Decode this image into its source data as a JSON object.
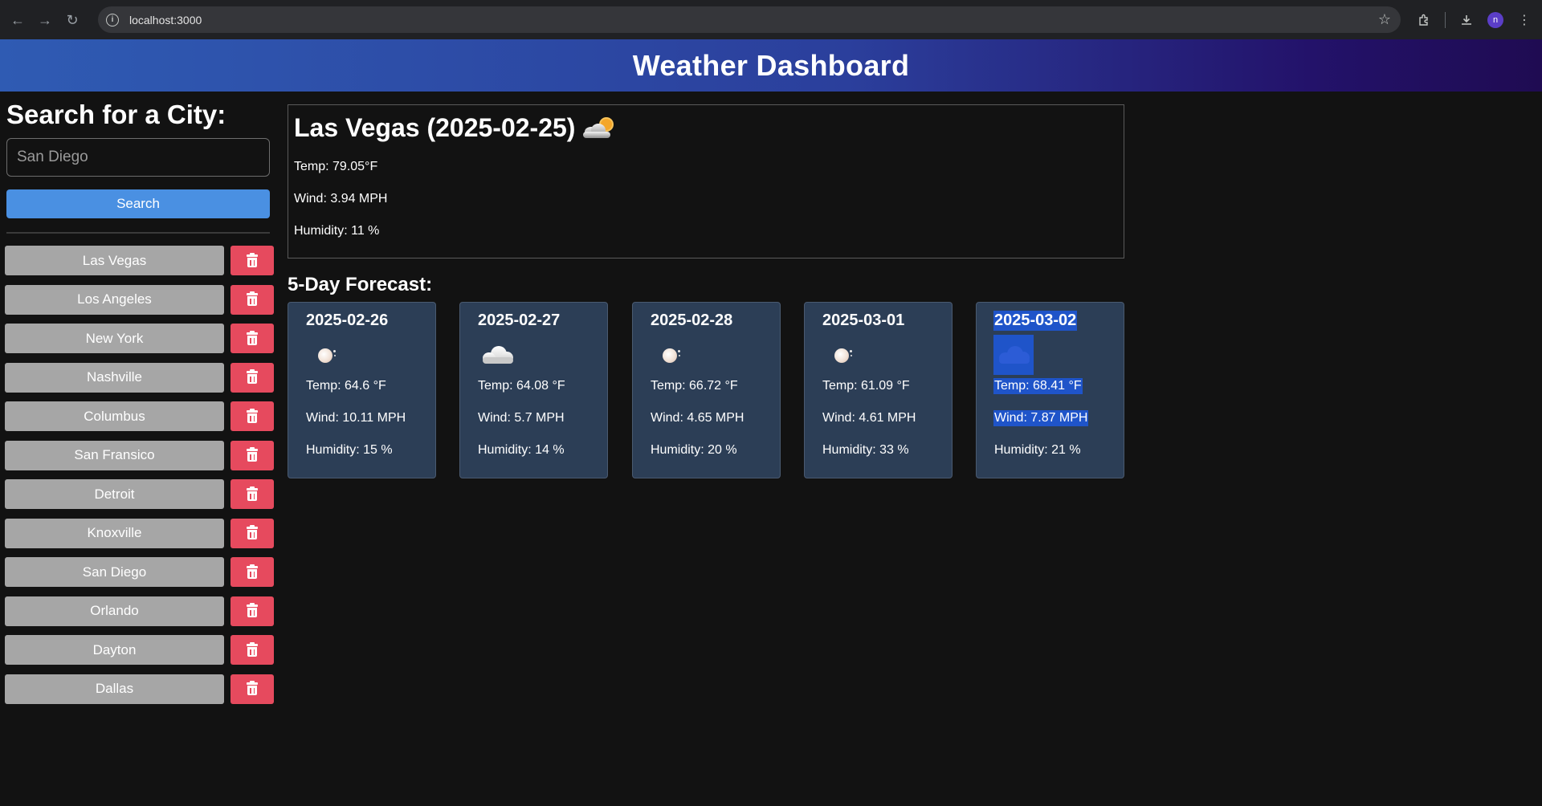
{
  "browser": {
    "url": "localhost:3000",
    "profile_initial": "n"
  },
  "header": {
    "title": "Weather Dashboard"
  },
  "sidebar": {
    "title": "Search for a City:",
    "search_placeholder": "San Diego",
    "search_label": "Search",
    "history": [
      {
        "label": "Las Vegas"
      },
      {
        "label": "Los Angeles"
      },
      {
        "label": "New York"
      },
      {
        "label": "Nashville"
      },
      {
        "label": "Columbus"
      },
      {
        "label": "San Fransico"
      },
      {
        "label": "Detroit"
      },
      {
        "label": "Knoxville"
      },
      {
        "label": "San Diego"
      },
      {
        "label": "Orlando"
      },
      {
        "label": "Dayton"
      },
      {
        "label": "Dallas"
      }
    ]
  },
  "current": {
    "heading": "Las Vegas (2025-02-25)",
    "icon": "partly-cloudy-icon",
    "temp": "Temp: 79.05°F",
    "wind": "Wind: 3.94 MPH",
    "humidity": "Humidity: 11 %"
  },
  "forecast": {
    "title": "5-Day Forecast:",
    "days": [
      {
        "date": "2025-02-26",
        "icon": "clear-sky-icon",
        "temp": "Temp: 64.6 °F",
        "wind": "Wind: 10.11 MPH",
        "humidity": "Humidity: 15 %"
      },
      {
        "date": "2025-02-27",
        "icon": "cloud-icon",
        "temp": "Temp: 64.08 °F",
        "wind": "Wind: 5.7 MPH",
        "humidity": "Humidity: 14 %"
      },
      {
        "date": "2025-02-28",
        "icon": "clear-sky-icon",
        "temp": "Temp: 66.72 °F",
        "wind": "Wind: 4.65 MPH",
        "humidity": "Humidity: 20 %"
      },
      {
        "date": "2025-03-01",
        "icon": "clear-sky-icon",
        "temp": "Temp: 61.09 °F",
        "wind": "Wind: 4.61 MPH",
        "humidity": "Humidity: 33 %"
      },
      {
        "date": "2025-03-02",
        "icon": "cloud-icon",
        "temp": "Temp: 68.41 °F",
        "wind": "Wind: 7.87 MPH",
        "humidity": "Humidity: 21 %"
      }
    ]
  },
  "colors": {
    "background": "#121212",
    "header_gradient_start": "#2f5bb3",
    "header_gradient_end": "#1f0b52",
    "search_button": "#4a90e2",
    "history_button": "#a6a6a6",
    "delete_button": "#e64a5e",
    "forecast_card": "#2c3e56",
    "selection": "#1f54c9"
  }
}
